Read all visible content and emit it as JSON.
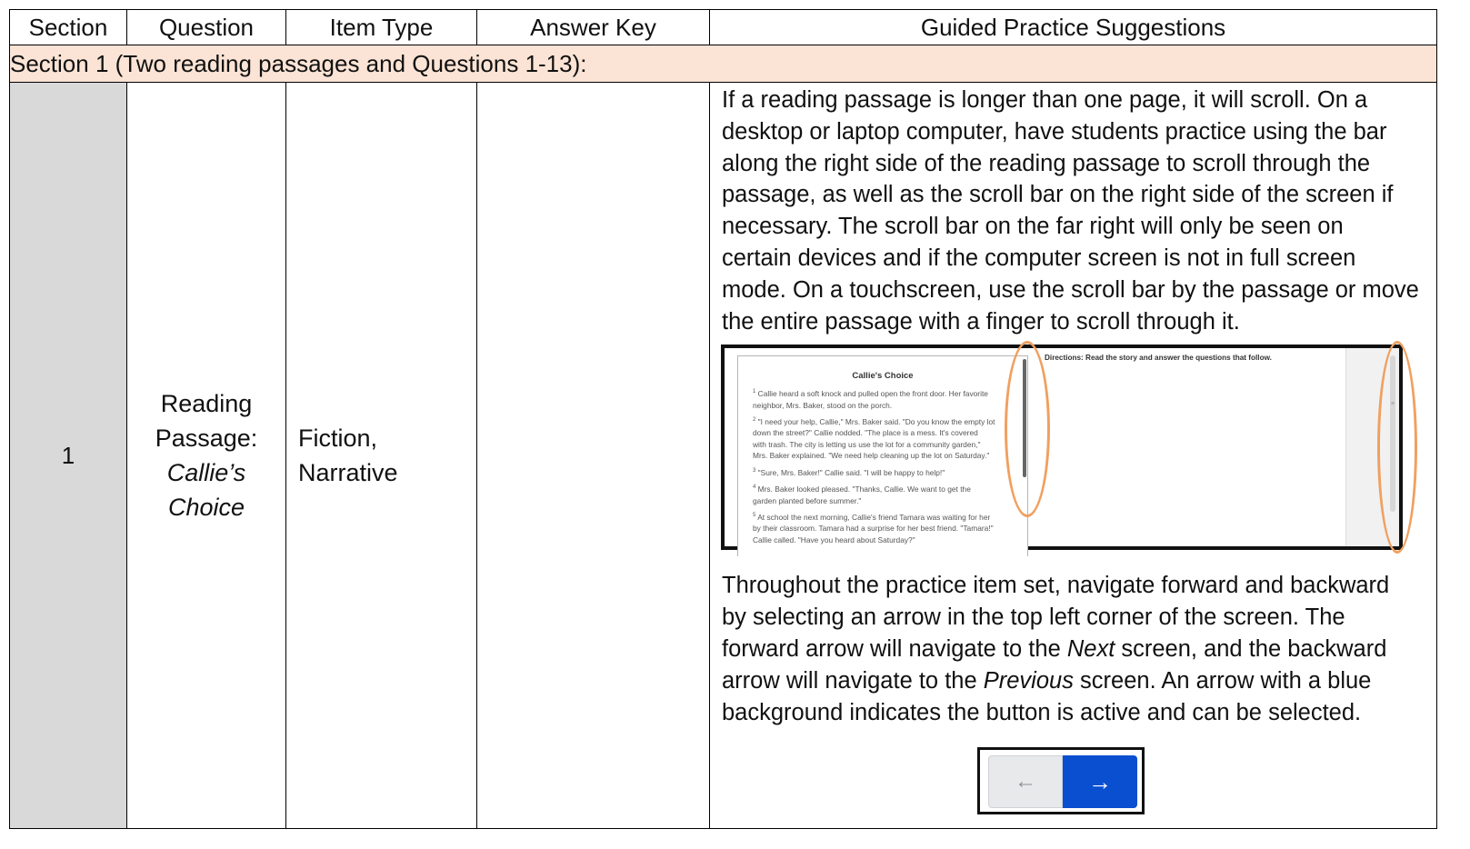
{
  "headers": {
    "section": "Section",
    "question": "Question",
    "item_type": "Item Type",
    "answer_key": "Answer Key",
    "guided": "Guided Practice Suggestions"
  },
  "section_heading": "Section 1 (Two reading passages and Questions 1-13):",
  "row": {
    "section_number": "1",
    "question_line1": "Reading",
    "question_line2": "Passage:",
    "question_title_line1": "Callie’s",
    "question_title_line2": "Choice",
    "item_type_line1": "Fiction,",
    "item_type_line2": "Narrative",
    "answer_key": ""
  },
  "guided": {
    "para1_lines": [
      "If a reading passage is longer than one page, it will scroll.  On a",
      "desktop or laptop computer, have students practice using the bar",
      "along the right side of the reading passage to scroll through the",
      "passage, as well as the scroll bar on the right side of the screen if",
      "necessary.  The scroll bar on the far right will only be seen on",
      "certain devices and if the computer screen is not in full screen",
      "mode. On a touchscreen, use the scroll bar by the passage or move",
      "the entire passage with a finger to scroll through it."
    ],
    "para2_line1": "Throughout the practice item set, navigate forward and backward",
    "para2_line2": "by selecting an arrow in the top left corner of the screen.  The",
    "para2_line3_a": "forward arrow will navigate to the ",
    "para2_line3_em": "Next",
    "para2_line3_b": " screen, and the backward",
    "para2_line4_a": "arrow will navigate to the ",
    "para2_line4_em": "Previous",
    "para2_line4_b": " screen.  An arrow with a blue",
    "para2_line5": "background indicates the button is active and can be selected."
  },
  "screenshot": {
    "passage_title": "Callie's Choice",
    "directions": "Directions: Read the story and answer the questions that follow.",
    "paragraphs": [
      {
        "num": "1",
        "lines": [
          "Callie heard a soft knock and pulled open the front door. Her favorite",
          "neighbor, Mrs. Baker, stood on the porch."
        ]
      },
      {
        "num": "2",
        "lines": [
          "\"I need your help, Callie,\" Mrs. Baker said. \"Do you know the empty lot",
          "down the street?\" Callie nodded. \"The place is a mess. It's covered",
          "with trash. The city is letting us use the lot for a community garden,\"",
          "Mrs. Baker explained. \"We need help cleaning up the lot on Saturday.\""
        ]
      },
      {
        "num": "3",
        "lines": [
          "\"Sure, Mrs. Baker!\" Callie said. \"I will be happy to help!\""
        ]
      },
      {
        "num": "4",
        "lines": [
          "Mrs. Baker looked pleased. \"Thanks, Callie. We want to get the",
          "garden planted before summer.\""
        ]
      },
      {
        "num": "5",
        "lines": [
          "At school the next morning, Callie's friend Tamara was waiting for her",
          "by their classroom. Tamara had a surprise for her best friend. \"Tamara!\"",
          "Callie called. \"Have you heard about Saturday?\""
        ]
      }
    ],
    "highlight_color": "#f0a060"
  },
  "nav": {
    "prev_arrow": "←",
    "next_arrow": "→",
    "active_color": "#0a4fd0"
  }
}
